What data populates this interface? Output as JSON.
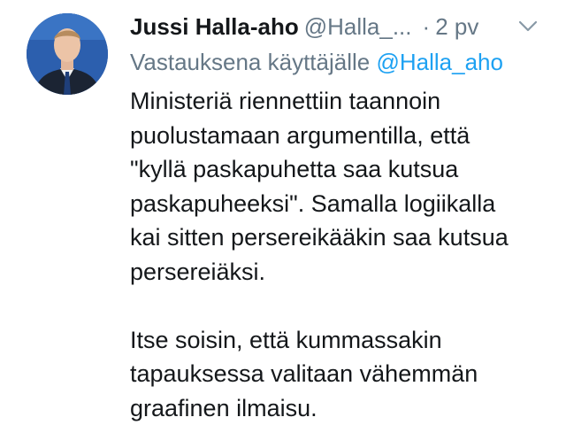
{
  "tweet": {
    "author_name": "Jussi Halla-aho",
    "author_handle": "@Halla_...",
    "separator": "·",
    "time": "2 pv",
    "reply_prefix": "Vastauksena käyttäjälle",
    "reply_to": "@Halla_aho",
    "paragraph1": [
      "Ministeriä riennettiin taannoin",
      "puolustamaan argumentilla, että",
      "\"kyllä paskapuhetta saa kutsua",
      "paskapuheeksi\". Samalla logiikalla",
      "kai sitten persereikääkin saa kutsua",
      "persereiäksi."
    ],
    "paragraph2": [
      "Itse soisin, että kummassakin",
      "tapauksessa valitaan vähemmän",
      "graafinen ilmaisu."
    ]
  },
  "icons": {
    "menu": "chevron-down-icon",
    "avatar": "avatar"
  },
  "colors": {
    "text": "#14171a",
    "secondary": "#657786",
    "link": "#1da1f2"
  }
}
